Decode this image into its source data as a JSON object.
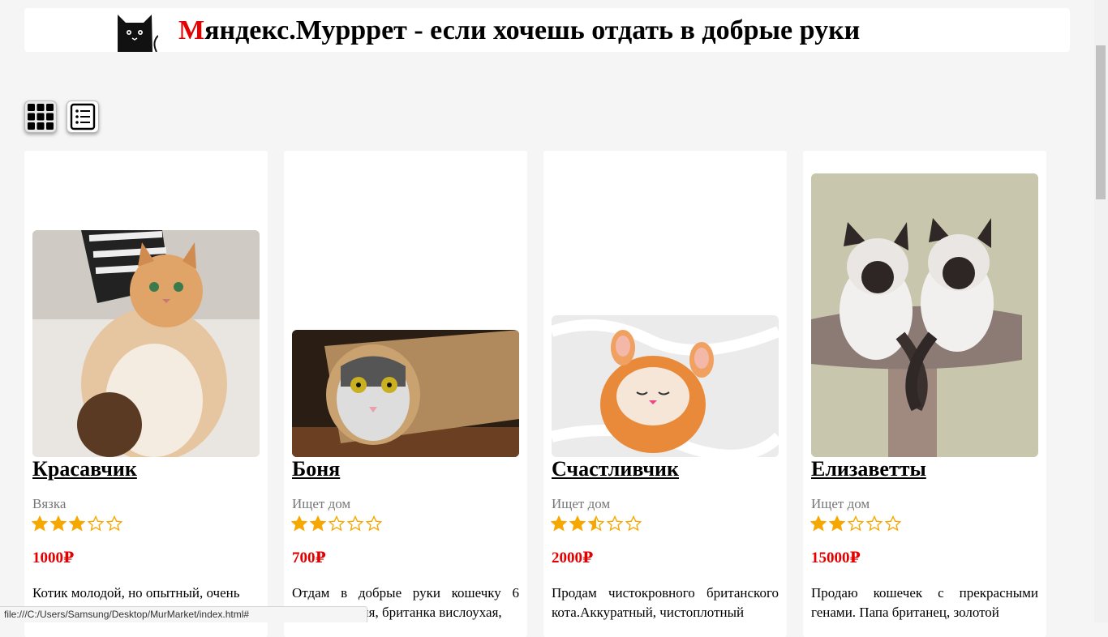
{
  "header": {
    "title_first_letter": "М",
    "title_rest": "яндекс.Мурррет - если хочешь отдать в добрые руки",
    "logo_icon": "black-cat-icon"
  },
  "view_toggle": {
    "grid_icon": "grid-view-icon",
    "list_icon": "list-view-icon"
  },
  "cards": [
    {
      "name": "Красавчик",
      "status": "Вязка",
      "rating": 3,
      "price": "1000₽",
      "description": "Котик молодой, но опытный, очень"
    },
    {
      "name": "Боня",
      "status": "Ищет дом",
      "rating": 2,
      "price": "700₽",
      "description": "Отдам в добрые руки кошечку 6 месяцев, Боня, британка вислоухая,"
    },
    {
      "name": "Счастливчик",
      "status": "Ищет дом",
      "rating": 2.5,
      "price": "2000₽",
      "description": "Продам чистокровного британского кота.Аккуратный, чистоплотный"
    },
    {
      "name": "Елизаветты",
      "status": "Ищет дом",
      "rating": 2,
      "price": "15000₽",
      "description": "Продаю кошечек с прекрасными генами. Папа британец, золотой"
    }
  ],
  "status_bar": {
    "url": "file:///C:/Users/Samsung/Desktop/MurMarket/index.html#"
  },
  "colors": {
    "accent_red": "#e30000",
    "star_orange": "#f6a800",
    "page_bg": "#f5f5f5"
  }
}
